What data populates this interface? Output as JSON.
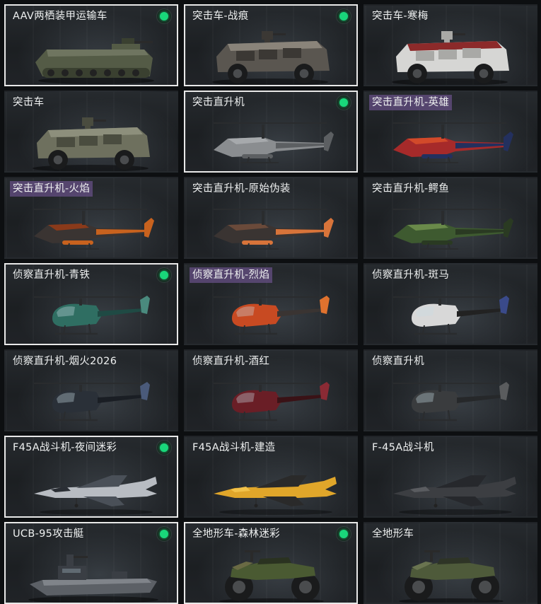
{
  "items": [
    {
      "name": "AAV两栖装甲运输车",
      "type": "aav",
      "selected": true,
      "owned": true,
      "highlight": false,
      "colors": [
        "#545b46",
        "#3a4030",
        "#6f7560"
      ]
    },
    {
      "name": "突击车-战痕",
      "type": "armored-car",
      "selected": true,
      "owned": true,
      "highlight": false,
      "colors": [
        "#5a5650",
        "#3b3834",
        "#8a847a"
      ]
    },
    {
      "name": "突击车-寒梅",
      "type": "armored-car",
      "selected": false,
      "owned": false,
      "highlight": false,
      "colors": [
        "#d6d6d4",
        "#a9a9a6",
        "#8c2a2a"
      ]
    },
    {
      "name": "突击车",
      "type": "armored-car",
      "selected": false,
      "owned": false,
      "highlight": false,
      "colors": [
        "#6e705e",
        "#4a4c3f",
        "#8d8f7c"
      ]
    },
    {
      "name": "突击直升机",
      "type": "attack-heli",
      "selected": true,
      "owned": true,
      "highlight": false,
      "colors": [
        "#8a8d90",
        "#5c5f62",
        "#a6a9ac"
      ]
    },
    {
      "name": "突击直升机-英雄",
      "type": "attack-heli",
      "selected": false,
      "owned": false,
      "highlight": true,
      "colors": [
        "#a62a2a",
        "#23305e",
        "#d24a2a"
      ]
    },
    {
      "name": "突击直升机-火焰",
      "type": "attack-heli",
      "selected": false,
      "owned": false,
      "highlight": true,
      "colors": [
        "#3a3432",
        "#c8621e",
        "#8a3a1a"
      ]
    },
    {
      "name": "突击直升机-原始伪装",
      "type": "attack-heli",
      "selected": false,
      "owned": false,
      "highlight": false,
      "colors": [
        "#3a3432",
        "#d8743a",
        "#6a4a3a"
      ]
    },
    {
      "name": "突击直升机-鳄鱼",
      "type": "attack-heli",
      "selected": false,
      "owned": false,
      "highlight": false,
      "colors": [
        "#3e5a30",
        "#2a3a22",
        "#6a8a4a"
      ]
    },
    {
      "name": "侦察直升机-青铁",
      "type": "scout-heli",
      "selected": true,
      "owned": true,
      "highlight": false,
      "colors": [
        "#2f6e62",
        "#1f4a44",
        "#4a8a7e"
      ]
    },
    {
      "name": "侦察直升机-烈焰",
      "type": "scout-heli",
      "selected": false,
      "owned": false,
      "highlight": true,
      "colors": [
        "#c84a22",
        "#3a3432",
        "#e0722e"
      ]
    },
    {
      "name": "侦察直升机-斑马",
      "type": "scout-heli",
      "selected": false,
      "owned": false,
      "highlight": false,
      "colors": [
        "#d8d8d8",
        "#222222",
        "#3a4a8a"
      ]
    },
    {
      "name": "侦察直升机-烟火2026",
      "type": "scout-heli",
      "selected": false,
      "owned": false,
      "highlight": false,
      "colors": [
        "#2a3038",
        "#1a1e24",
        "#4a5a7a"
      ]
    },
    {
      "name": "侦察直升机-酒红",
      "type": "scout-heli",
      "selected": false,
      "owned": false,
      "highlight": false,
      "colors": [
        "#6a1e26",
        "#3a1216",
        "#8a2a34"
      ]
    },
    {
      "name": "侦察直升机",
      "type": "scout-heli",
      "selected": false,
      "owned": false,
      "highlight": false,
      "colors": [
        "#3a3c3e",
        "#26282a",
        "#5a5c5e"
      ]
    },
    {
      "name": "F45A战斗机-夜间迷彩",
      "type": "jet",
      "selected": true,
      "owned": true,
      "highlight": false,
      "colors": [
        "#b8bcc2",
        "#4a5058",
        "#2a2e34"
      ]
    },
    {
      "name": "F45A战斗机-建造",
      "type": "jet",
      "selected": false,
      "owned": false,
      "highlight": false,
      "colors": [
        "#e0a62a",
        "#2a2a2a",
        "#f2c24a"
      ]
    },
    {
      "name": "F-45A战斗机",
      "type": "jet",
      "selected": false,
      "owned": false,
      "highlight": false,
      "colors": [
        "#3c3e42",
        "#26282c",
        "#5a5c60"
      ]
    },
    {
      "name": "UCB-95攻击艇",
      "type": "boat",
      "selected": true,
      "owned": true,
      "highlight": false,
      "colors": [
        "#5c6066",
        "#3a3e44",
        "#80848a"
      ]
    },
    {
      "name": "全地形车-森林迷彩",
      "type": "atv",
      "selected": true,
      "owned": true,
      "highlight": false,
      "colors": [
        "#4a5a32",
        "#2a3220",
        "#6a6a44"
      ]
    },
    {
      "name": "全地形车",
      "type": "atv",
      "selected": false,
      "owned": false,
      "highlight": false,
      "colors": [
        "#4e5a3a",
        "#2e3426",
        "#6a7450"
      ]
    }
  ]
}
